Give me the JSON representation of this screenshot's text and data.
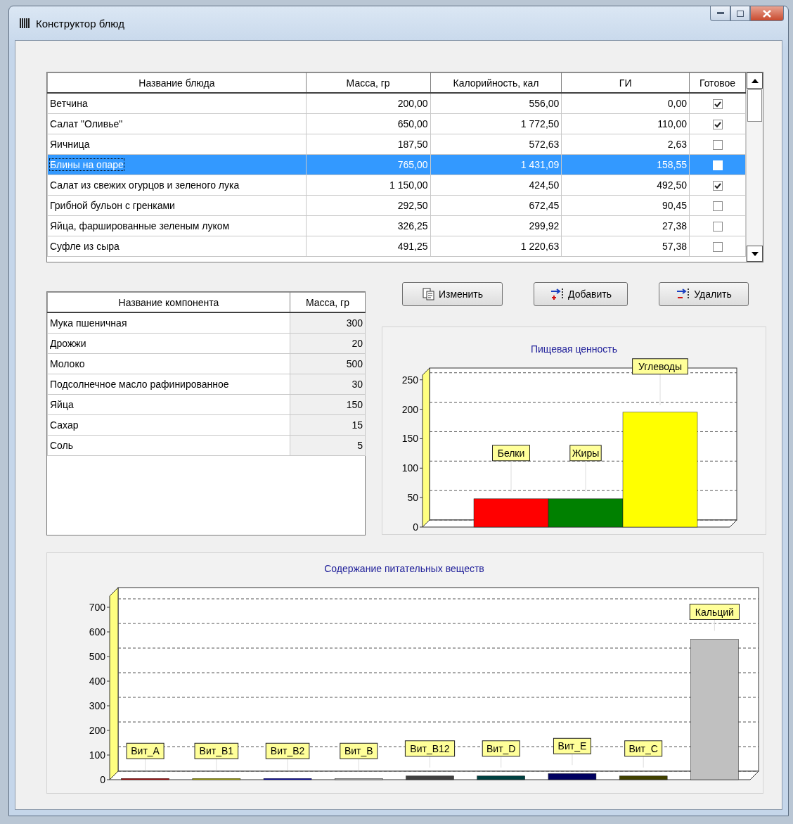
{
  "window": {
    "title": "Конструктор блюд"
  },
  "dishes": {
    "columns": [
      "Название блюда",
      "Масса, гр",
      "Калорийность, кал",
      "ГИ",
      "Готовое"
    ],
    "rows": [
      {
        "name": "Ветчина",
        "mass": "200,00",
        "calories": "556,00",
        "gi": "0,00",
        "ready": true,
        "selected": false
      },
      {
        "name": "Салат \"Оливье\"",
        "mass": "650,00",
        "calories": "1 772,50",
        "gi": "110,00",
        "ready": true,
        "selected": false
      },
      {
        "name": "Яичница",
        "mass": "187,50",
        "calories": "572,63",
        "gi": "2,63",
        "ready": false,
        "selected": false
      },
      {
        "name": "Блины на опаре",
        "mass": "765,00",
        "calories": "1 431,09",
        "gi": "158,55",
        "ready": false,
        "selected": true
      },
      {
        "name": "Салат из свежих огурцов и зеленого лука",
        "mass": "1 150,00",
        "calories": "424,50",
        "gi": "492,50",
        "ready": true,
        "selected": false
      },
      {
        "name": "Грибной бульон с гренками",
        "mass": "292,50",
        "calories": "672,45",
        "gi": "90,45",
        "ready": false,
        "selected": false
      },
      {
        "name": "Яйца, фаршированные зеленым луком",
        "mass": "326,25",
        "calories": "299,92",
        "gi": "27,38",
        "ready": false,
        "selected": false
      },
      {
        "name": "Суфле из сыра",
        "mass": "491,25",
        "calories": "1 220,63",
        "gi": "57,38",
        "ready": false,
        "selected": false
      }
    ]
  },
  "components": {
    "columns": [
      "Название компонента",
      "Масса, гр"
    ],
    "rows": [
      {
        "name": "Мука пшеничная",
        "mass": "300"
      },
      {
        "name": "Дрожжи",
        "mass": "20"
      },
      {
        "name": "Молоко",
        "mass": "500"
      },
      {
        "name": "Подсолнечное масло рафинированное",
        "mass": "30"
      },
      {
        "name": "Яйца",
        "mass": "150"
      },
      {
        "name": "Сахар",
        "mass": "15"
      },
      {
        "name": "Соль",
        "mass": "5"
      }
    ]
  },
  "buttons": [
    {
      "label": "Изменить",
      "kind": "edit"
    },
    {
      "label": "Добавить",
      "kind": "add"
    },
    {
      "label": "Удалить",
      "kind": "delete"
    }
  ],
  "nutrition_chart": {
    "chart_data": {
      "type": "bar",
      "title": "Пищевая ценность",
      "series": [
        {
          "colors": [
            "#ff0000",
            "#008000",
            "#ffff00"
          ],
          "values": [
            48,
            48,
            195
          ]
        }
      ],
      "ylim": [
        0,
        270
      ],
      "yticks": [
        0,
        50,
        100,
        150,
        200,
        250
      ],
      "value_labels": [
        "Белки",
        "Жиры",
        "Углеводы"
      ]
    }
  },
  "nutrients_chart": {
    "chart_data": {
      "type": "bar",
      "title": "Содержание питательных веществ",
      "series": [
        {
          "colors": [
            "#c00000",
            "#c0c000",
            "#0000c0",
            "#c0c0c0",
            "#404040",
            "#004040",
            "#000060",
            "#404000",
            "#c0c0c0"
          ],
          "values": [
            5,
            5,
            5,
            5,
            15,
            15,
            25,
            15,
            570
          ]
        }
      ],
      "ylim": [
        0,
        780
      ],
      "yticks": [
        0,
        100,
        200,
        300,
        400,
        500,
        600,
        700
      ],
      "value_labels": [
        "Вит_A",
        "Вит_B1",
        "Вит_B2",
        "Вит_B",
        "Вит_B12",
        "Вит_D",
        "Вит_E",
        "Вит_C",
        "Кальций"
      ]
    }
  }
}
